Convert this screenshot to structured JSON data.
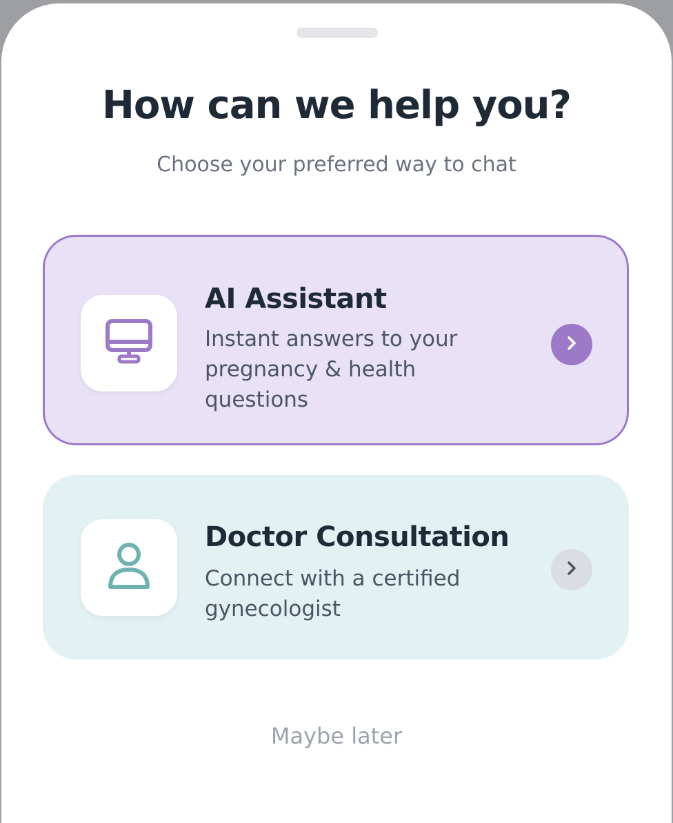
{
  "sheet": {
    "title": "How can we help you?",
    "subtitle": "Choose your preferred way to chat"
  },
  "options": [
    {
      "title": "AI Assistant",
      "description": "Instant answers to your pregnancy & health questions",
      "icon": "monitor-icon",
      "accent_color": "#9d7ac8",
      "background_color": "#e9e1f6",
      "selected": true
    },
    {
      "title": "Doctor Consultation",
      "description": "Connect with a certified gynecologist",
      "icon": "person-icon",
      "accent_color": "#6fb3b1",
      "background_color": "#e2f2f2",
      "selected": false
    }
  ],
  "dismiss_label": "Maybe later",
  "colors": {
    "title": "#1f2a37",
    "subtitle": "#6b7280",
    "dismiss": "#9ca3af"
  }
}
